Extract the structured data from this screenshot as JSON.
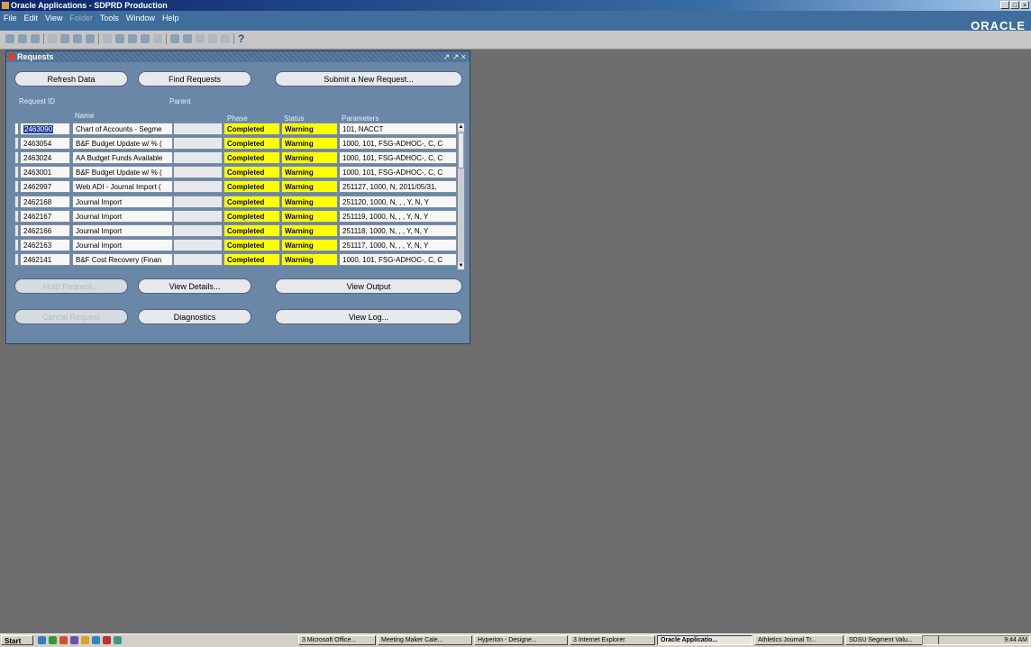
{
  "app": {
    "title": "Oracle Applications - SDPRD Production",
    "brand": "ORACLE",
    "menu": [
      {
        "label": "File",
        "enabled": true
      },
      {
        "label": "Edit",
        "enabled": true
      },
      {
        "label": "View",
        "enabled": true
      },
      {
        "label": "Folder",
        "enabled": false
      },
      {
        "label": "Tools",
        "enabled": true
      },
      {
        "label": "Window",
        "enabled": true
      },
      {
        "label": "Help",
        "enabled": true
      }
    ],
    "help_glyph": "?"
  },
  "requests": {
    "title": "Requests",
    "window_controls": "↗ ↗ ×",
    "refresh_label": "Refresh Data",
    "find_label": "Find Requests",
    "submit_label": "Submit a New Request...",
    "columns": {
      "request_id": "Request ID",
      "name": "Name",
      "parent": "Parent",
      "phase": "Phase",
      "status": "Status",
      "parameters": "Parameters"
    },
    "rows": [
      {
        "id": "2463090",
        "name": "Chart of Accounts - Segme",
        "parent": "",
        "phase": "Completed",
        "status": "Warning",
        "params": "101, NACCT"
      },
      {
        "id": "2463054",
        "name": "B&F Budget Update w/ % (",
        "parent": "",
        "phase": "Completed",
        "status": "Warning",
        "params": "1000, 101, FSG-ADHOC-, C, C"
      },
      {
        "id": "2463024",
        "name": "AA Budget Funds Available",
        "parent": "",
        "phase": "Completed",
        "status": "Warning",
        "params": "1000, 101, FSG-ADHOC-, C, C"
      },
      {
        "id": "2463001",
        "name": "B&F Budget Update w/ % (",
        "parent": "",
        "phase": "Completed",
        "status": "Warning",
        "params": "1000, 101, FSG-ADHOC-, C, C"
      },
      {
        "id": "2462997",
        "name": "Web ADI - Journal Import (",
        "parent": "",
        "phase": "Completed",
        "status": "Warning",
        "params": "251127, 1000, N, 2011/05/31,"
      },
      {
        "id": "2462168",
        "name": "Journal Import",
        "parent": "",
        "phase": "Completed",
        "status": "Warning",
        "params": "251120, 1000, N, , , Y, N, Y"
      },
      {
        "id": "2462167",
        "name": "Journal Import",
        "parent": "",
        "phase": "Completed",
        "status": "Warning",
        "params": "251119, 1000, N, , , Y, N, Y"
      },
      {
        "id": "2462166",
        "name": "Journal Import",
        "parent": "",
        "phase": "Completed",
        "status": "Warning",
        "params": "251118, 1000, N, , , Y, N, Y"
      },
      {
        "id": "2462163",
        "name": "Journal Import",
        "parent": "",
        "phase": "Completed",
        "status": "Warning",
        "params": "251117, 1000, N, , , Y, N, Y"
      },
      {
        "id": "2462141",
        "name": "B&F Cost Recovery (Finan",
        "parent": "",
        "phase": "Completed",
        "status": "Warning",
        "params": "1000, 101, FSG-ADHOC-, C, C"
      }
    ],
    "hold_label": "Hold Request...",
    "view_details_label": "View Details...",
    "view_output_label": "View Output",
    "cancel_label": "Cancel Request",
    "diagnostics_label": "Diagnostics",
    "view_log_label": "View Log..."
  },
  "taskbar": {
    "start_label": "Start",
    "tasks": [
      "3 Microsoft Office...",
      "Meeting Maker Cale...",
      "Hyperion - Designe...",
      "3 Internet Explorer",
      "Oracle Applicatio...",
      "Athletics Journal Tr...",
      "SDSU Segment Valu..."
    ],
    "active_task": "Oracle Applicatio...",
    "clock": "9:44 AM"
  },
  "colors": {
    "desktop": "#6e6e6e",
    "window_body": "#6b87a8",
    "highlight_phase": "#ffff00",
    "selection": "#1f3f9f"
  }
}
